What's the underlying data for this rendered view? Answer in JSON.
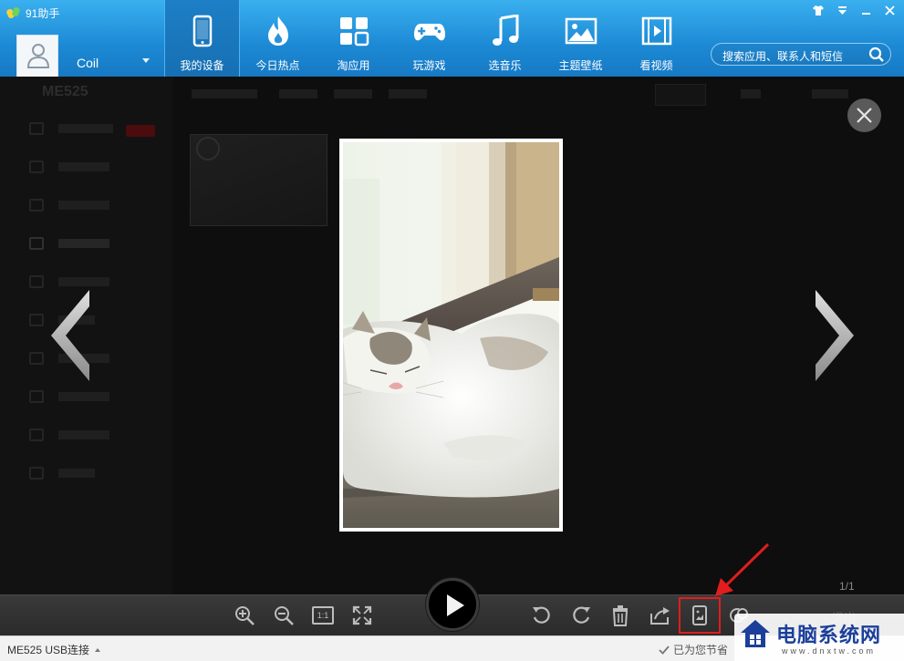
{
  "app": {
    "title": "91助手"
  },
  "window_controls": [
    "shirt-icon",
    "menu-icon",
    "minimize-icon",
    "close-icon"
  ],
  "user": {
    "name": "Coil"
  },
  "nav": [
    {
      "label": "我的设备",
      "icon": "phone-icon",
      "active": true
    },
    {
      "label": "今日热点",
      "icon": "flame-icon",
      "active": false
    },
    {
      "label": "淘应用",
      "icon": "apps-grid-icon",
      "active": false
    },
    {
      "label": "玩游戏",
      "icon": "gamepad-icon",
      "active": false
    },
    {
      "label": "选音乐",
      "icon": "music-note-icon",
      "active": false
    },
    {
      "label": "主题壁纸",
      "icon": "picture-icon",
      "active": false
    },
    {
      "label": "看视频",
      "icon": "film-icon",
      "active": false
    }
  ],
  "search": {
    "placeholder": "搜索应用、联系人和短信"
  },
  "background": {
    "device_name": "ME525",
    "sidebar_item_count": 10
  },
  "viewer": {
    "counter": "1/1",
    "exit_label": "退出",
    "controls": [
      "zoom-in-icon",
      "zoom-out-icon",
      "actual-size-icon",
      "fullscreen-icon",
      "play-icon",
      "rotate-left-icon",
      "rotate-right-icon",
      "delete-icon",
      "share-icon",
      "set-wallpaper-icon",
      "sync-icon"
    ],
    "actual_size_label": "1:1"
  },
  "status": {
    "connection": "ME525  USB连接",
    "saved_text": "已为您节省"
  },
  "watermark": {
    "brand": "电脑系统网",
    "url": "www.dnxtw.com"
  },
  "colors": {
    "header_blue": "#1c89d4",
    "highlight_red": "#e11d1d",
    "control_bar": "#2b2b2b"
  }
}
